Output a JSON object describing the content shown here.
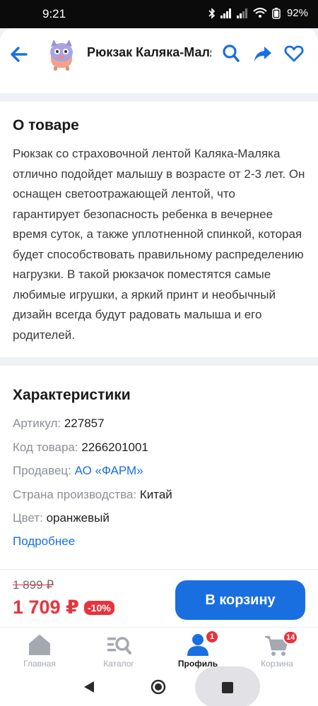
{
  "status_bar": {
    "time": "9:21",
    "battery": "92",
    "icons": [
      "bluetooth-icon",
      "signal-icon",
      "signal-icon",
      "wifi-icon",
      "battery-icon"
    ]
  },
  "header": {
    "title": "Рюкзак Каляка-Маляка",
    "back_icon": "arrow-left-icon",
    "actions": [
      "search-icon",
      "share-icon",
      "heart-icon"
    ],
    "accent": "#1a6fe0"
  },
  "about": {
    "heading": "О товаре",
    "text": "Рюкзак со страховочной лентой Каляка-Маляка отлично подойдет малышу в возрасте от 2-3 лет. Он оснащен светоотражающей лентой, что гарантирует безопасность ребенка в вечернее время суток, а также уплотненной спинкой, которая будет способствовать правильному распределению нагрузки. В такой рюкзачок поместятся самые любимые игрушки, а яркий принт и необычный дизайн всегда будут радовать малыша и его родителей."
  },
  "characteristics": {
    "heading": "Характеристики",
    "rows": [
      {
        "label": "Артикул:",
        "value": "227857"
      },
      {
        "label": "Код товара:",
        "value": "2266201001"
      },
      {
        "label": "Продавец:",
        "value": "АО «ФАРМ»"
      },
      {
        "label": "Страна производства:",
        "value": "Китай"
      },
      {
        "label": "Цвет:",
        "value": "оранжевый"
      }
    ],
    "more_link": "Подробнее"
  },
  "buy": {
    "old_price": "1 899 ₽",
    "new_price": "1 709 ₽",
    "discount": "-10%",
    "cart_button": "В корзину",
    "price_color": "#e8323c"
  },
  "tabs": [
    {
      "label": "Главная",
      "icon": "home-icon"
    },
    {
      "label": "Каталог",
      "icon": "catalog-icon"
    },
    {
      "label": "Профиль",
      "icon": "profile-icon",
      "badge": "1",
      "active": true
    },
    {
      "label": "Корзина",
      "icon": "cart-icon",
      "badge": "14"
    }
  ],
  "system_nav": [
    "back-triangle-icon",
    "home-circle-icon",
    "recents-square-icon"
  ]
}
